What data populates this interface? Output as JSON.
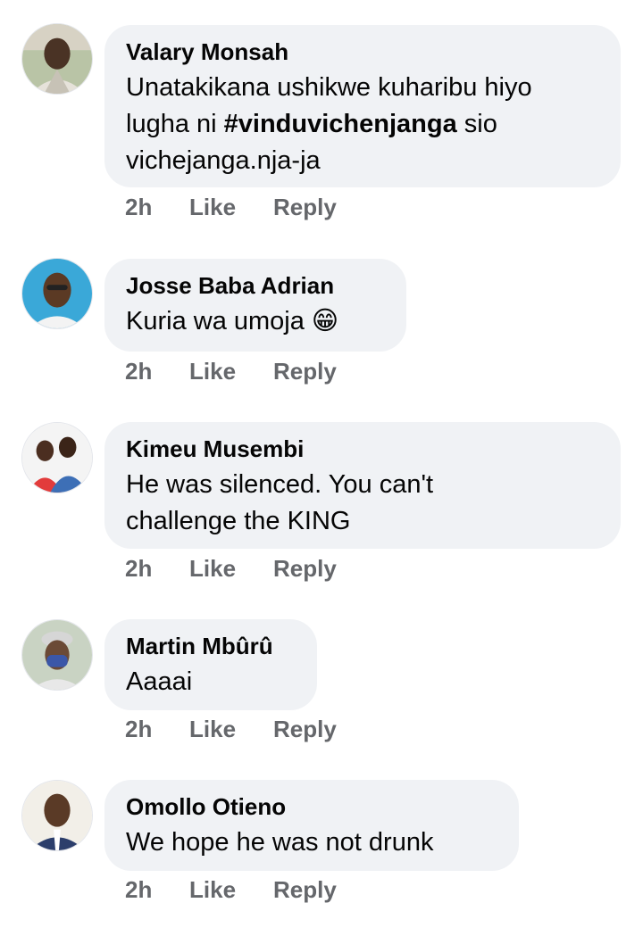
{
  "comments": [
    {
      "author": "Valary Monsah",
      "text_before": "Unatakikana ushikwe kuharibu hiyo\nlugha ni ",
      "hashtag": "#vinduvichenjanga",
      "text_after": " sio\nvichejanga.nja-ja",
      "time": "2h",
      "like_label": "Like",
      "reply_label": "Reply"
    },
    {
      "author": "Josse Baba Adrian",
      "text": "Kuria wa umoja 😁",
      "time": "2h",
      "like_label": "Like",
      "reply_label": "Reply"
    },
    {
      "author": "Kimeu Musembi",
      "text": "He was silenced. You can't\nchallenge the KING",
      "time": "2h",
      "like_label": "Like",
      "reply_label": "Reply"
    },
    {
      "author": "Martin Mbûrû",
      "text": "Aaaai",
      "time": "2h",
      "like_label": "Like",
      "reply_label": "Reply"
    },
    {
      "author": "Omollo Otieno",
      "text": "We hope he was not drunk",
      "time": "2h",
      "like_label": "Like",
      "reply_label": "Reply"
    }
  ],
  "colors": {
    "bubble": "#f0f2f5",
    "author": "#050505",
    "meta": "#65676b"
  }
}
